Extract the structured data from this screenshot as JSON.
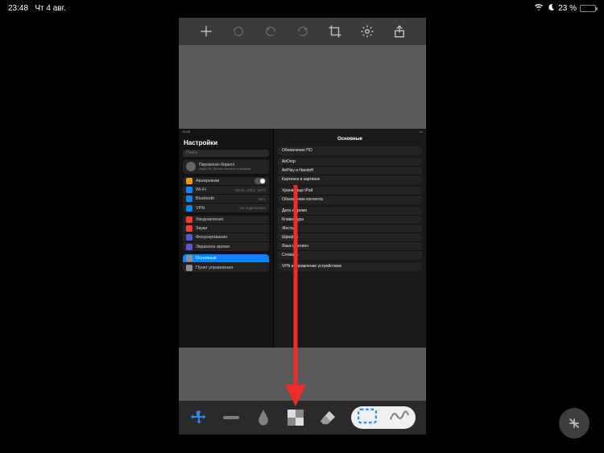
{
  "status_bar": {
    "time": "23:48",
    "date": "Чт 4 авг.",
    "battery_percent": "23 %"
  },
  "top_toolbar": {
    "add": "add-icon",
    "rotate": "rotate-icon",
    "undo": "undo-icon",
    "redo": "redo-icon",
    "crop": "crop-icon",
    "settings": "settings-icon",
    "share": "share-icon"
  },
  "bottom_toolbar": {
    "move": "move-icon",
    "minus": "minus-icon",
    "blur": "blur-drop-icon",
    "pixelate": "pixelate-icon",
    "erase": "eraser-icon",
    "rect_select": "rectangle-select-icon",
    "freehand": "freehand-icon"
  },
  "screenshot": {
    "inner_time": "23:48",
    "title": "Настройки",
    "search_placeholder": "Поиск",
    "profile": {
      "name": "Пироженко Кирилл",
      "subtitle": "Apple ID, iCloud, контент и покупки"
    },
    "group1": [
      {
        "label": "Авиарежим",
        "color": "#ff9500",
        "toggle": true
      },
      {
        "label": "Wi-Fi",
        "color": "#0a84ff",
        "value": "ASUS_2Ghz_Wi-Fi"
      },
      {
        "label": "Bluetooth",
        "color": "#0a84ff",
        "value": "Вкл."
      },
      {
        "label": "VPN",
        "color": "#0a84ff",
        "value": "Не подключено"
      }
    ],
    "group2": [
      {
        "label": "Уведомления",
        "color": "#ff3b30"
      },
      {
        "label": "Звуки",
        "color": "#ff3b30"
      },
      {
        "label": "Фокусирование",
        "color": "#5856d6"
      },
      {
        "label": "Экранное время",
        "color": "#5856d6"
      }
    ],
    "group3": [
      {
        "label": "Основные",
        "color": "#8e8e93",
        "selected": true
      },
      {
        "label": "Пункт управления",
        "color": "#8e8e93"
      }
    ],
    "detail_title": "Основные",
    "detail_groups": [
      [
        "Обновление ПО"
      ],
      [
        "AirDrop",
        "AirPlay и Handoff",
        "Картинка в картинке"
      ],
      [
        "Хранилище iPad",
        "Обновление контента"
      ],
      [
        "Дата и время",
        "Клавиатура",
        "Жесты",
        "Шрифты",
        "Язык и регион",
        "Словарь"
      ],
      [
        "VPN и управление устройством"
      ]
    ]
  },
  "colors": {
    "arrow": "#ef2c2c",
    "select_blue": "#2b90ff",
    "move_blue": "#2b90ff"
  }
}
